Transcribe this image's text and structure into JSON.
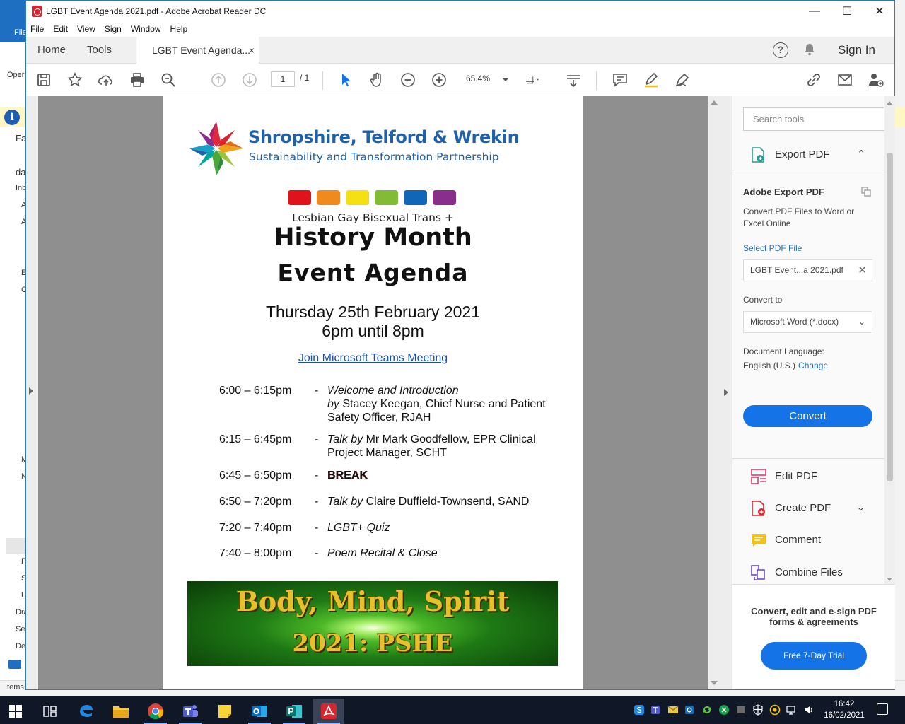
{
  "window": {
    "title": "LGBT Event Agenda 2021.pdf - Adobe Acrobat Reader DC",
    "controls": {
      "minimize": "—",
      "maximize": "☐",
      "close": "✕"
    }
  },
  "menu": [
    "File",
    "Edit",
    "View",
    "Sign",
    "Window",
    "Help"
  ],
  "tabs": {
    "home": "Home",
    "tools": "Tools",
    "document": "LGBT Event Agenda...",
    "close": "×",
    "signin": "Sign In",
    "help": "?"
  },
  "toolbar": {
    "current_page": "1",
    "total_pages": "/ 1",
    "zoom": "65.4%"
  },
  "document": {
    "org_line1": "Shropshire, Telford & Wrekin",
    "org_line2": "Sustainability and Transformation Partnership",
    "rainbow_colors": [
      "#e0121b",
      "#f08a1e",
      "#f5e015",
      "#82bb35",
      "#1166b8",
      "#8a2e8c"
    ],
    "subtitle": "Lesbian Gay Bisexual Trans +",
    "heading1": "History Month",
    "heading2": "Event Agenda",
    "date_line1": "Thursday 25th February 2021",
    "date_line2": "6pm until 8pm",
    "teams_link": "Join Microsoft Teams Meeting",
    "agenda": [
      {
        "time": "6:00 – 6:15pm",
        "dash": "-",
        "italic": "Welcome and Introduction",
        "italic2": "by",
        "text": "Stacey Keegan, Chief Nurse and Patient Safety Officer, RJAH"
      },
      {
        "time": "6:15 – 6:45pm",
        "dash": "-",
        "italic": "Talk by",
        "text": "Mr Mark Goodfellow, EPR Clinical Project Manager, SCHT"
      },
      {
        "time": "6:45 – 6:50pm",
        "dash": "-",
        "text": "BREAK"
      },
      {
        "time": "6:50 – 7:20pm",
        "dash": "-",
        "italic": "Talk by",
        "text": "Claire Duffield-Townsend, SAND"
      },
      {
        "time": "7:20 – 7:40pm",
        "dash": "-",
        "italic": "LGBT+ Quiz"
      },
      {
        "time": "7:40 – 8:00pm",
        "dash": "-",
        "italic": "Poem Recital & Close"
      }
    ],
    "banner_line1": "Body, Mind, Spirit",
    "banner_line2": "2021: PSHE"
  },
  "tools_pane": {
    "search_placeholder": "Search tools",
    "export_pdf": "Export PDF",
    "adobe_export_title": "Adobe Export PDF",
    "adobe_export_desc": "Convert PDF Files to Word or Excel Online",
    "select_pdf_file": "Select PDF File",
    "file_name": "LGBT Event...a 2021.pdf",
    "convert_to_label": "Convert to",
    "convert_to_value": "Microsoft Word (*.docx)",
    "doc_language_label": "Document Language:",
    "doc_language_value": "English (U.S.)",
    "change": "Change",
    "convert_button": "Convert",
    "tools": [
      "Edit PDF",
      "Create PDF",
      "Comment",
      "Combine Files"
    ],
    "promo_text": "Convert, edit and e-sign PDF forms & agreements",
    "trial_button": "Free 7-Day Trial"
  },
  "background_app": {
    "fragments": [
      "File",
      "Oper",
      "Fa",
      "da",
      "Inb",
      "A",
      "A",
      "E",
      "C",
      "M",
      "N",
      "P",
      "S",
      "U",
      "Dra",
      "Sei",
      "De"
    ],
    "status_items": "Items"
  },
  "taskbar": {
    "time": "16:42",
    "date": "16/02/2021"
  },
  "colors": {
    "acrobat_red": "#d8262f",
    "accent_blue": "#1473e6",
    "link_blue": "#1f6fbf",
    "org_blue": "#1f61a9"
  }
}
